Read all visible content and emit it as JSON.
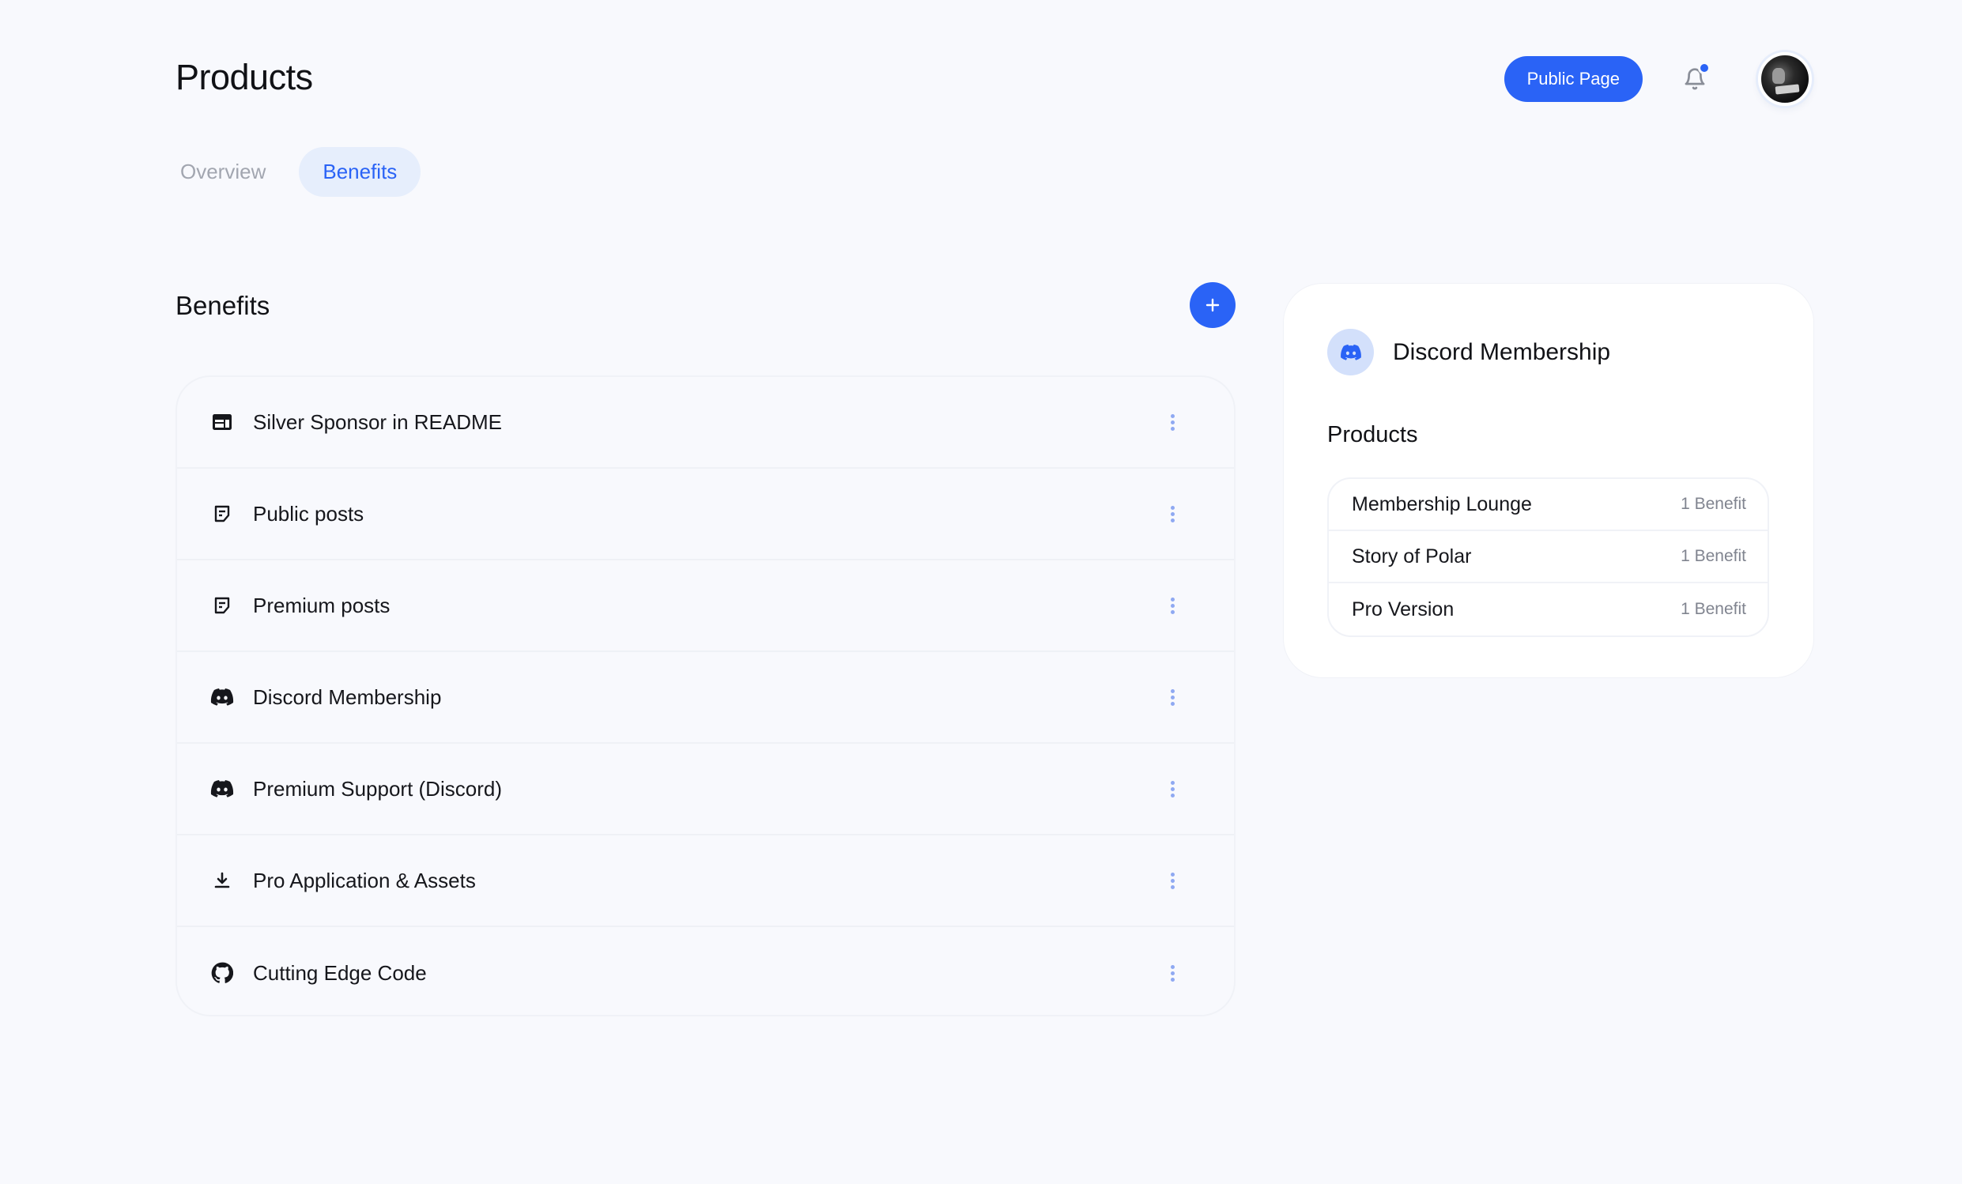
{
  "header": {
    "title": "Products",
    "public_page_label": "Public Page",
    "notification_icon": "bell-icon",
    "has_unread_notifications": true,
    "avatar_icon": "user-avatar"
  },
  "tabs": [
    {
      "label": "Overview",
      "active": false
    },
    {
      "label": "Benefits",
      "active": true
    }
  ],
  "benefits": {
    "title": "Benefits",
    "add_icon": "plus-icon",
    "items": [
      {
        "label": "Silver Sponsor in README",
        "icon": "ad-banner-icon"
      },
      {
        "label": "Public posts",
        "icon": "post-icon"
      },
      {
        "label": "Premium posts",
        "icon": "post-icon"
      },
      {
        "label": "Discord Membership",
        "icon": "discord-icon"
      },
      {
        "label": "Premium Support (Discord)",
        "icon": "discord-icon"
      },
      {
        "label": "Pro Application & Assets",
        "icon": "download-icon"
      },
      {
        "label": "Cutting Edge Code",
        "icon": "github-icon"
      }
    ]
  },
  "detail": {
    "icon": "discord-icon",
    "title": "Discord Membership",
    "products_heading": "Products",
    "products": [
      {
        "name": "Membership Lounge",
        "count": "1 Benefit"
      },
      {
        "name": "Story of Polar",
        "count": "1 Benefit"
      },
      {
        "name": "Pro Version",
        "count": "1 Benefit"
      }
    ]
  },
  "colors": {
    "accent": "#2a63f6",
    "accent_soft": "#e6eefc",
    "background": "#f8f9fd",
    "kebab": "#8fa9f2"
  }
}
